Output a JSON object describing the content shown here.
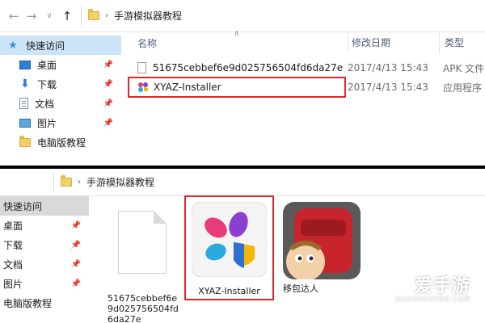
{
  "top_window": {
    "breadcrumb": "手游模拟器教程",
    "nav": {
      "items": [
        {
          "label": "快速访问",
          "selected": true
        },
        {
          "label": "桌面",
          "pinned": true
        },
        {
          "label": "下载",
          "pinned": true
        },
        {
          "label": "文档",
          "pinned": true
        },
        {
          "label": "图片",
          "pinned": true
        },
        {
          "label": "电脑版教程",
          "pinned": false
        }
      ]
    },
    "columns": {
      "name": "名称",
      "date": "修改日期",
      "type": "类型"
    },
    "files": [
      {
        "name": "51675cebbef6e9d025756504fd6da27e",
        "date": "2017/4/13 15:43",
        "type": "APK 文件"
      },
      {
        "name": "XYAZ-Installer",
        "date": "2017/4/13 15:43",
        "type": "应用程序",
        "highlighted": true
      }
    ]
  },
  "bottom_window": {
    "breadcrumb": "手游模拟器教程",
    "nav": {
      "items": [
        {
          "label": "快速访问",
          "selected": true
        },
        {
          "label": "桌面",
          "pinned": true
        },
        {
          "label": "下载",
          "pinned": true
        },
        {
          "label": "文档",
          "pinned": true
        },
        {
          "label": "图片",
          "pinned": true
        },
        {
          "label": "电脑版教程",
          "pinned": false
        }
      ]
    },
    "tiles": [
      {
        "name_lines": [
          "51675cebbef6e",
          "9d025756504fd",
          "6da27e"
        ]
      },
      {
        "name": "XYAZ-Installer",
        "highlighted": true
      },
      {
        "name": "移包达人"
      }
    ]
  },
  "watermark": {
    "text": "爱手游",
    "sub": "GAOSHOUYOU.COM"
  },
  "colors": {
    "highlight_border": "#e0262b",
    "nav_selected": "#cce4f7"
  }
}
